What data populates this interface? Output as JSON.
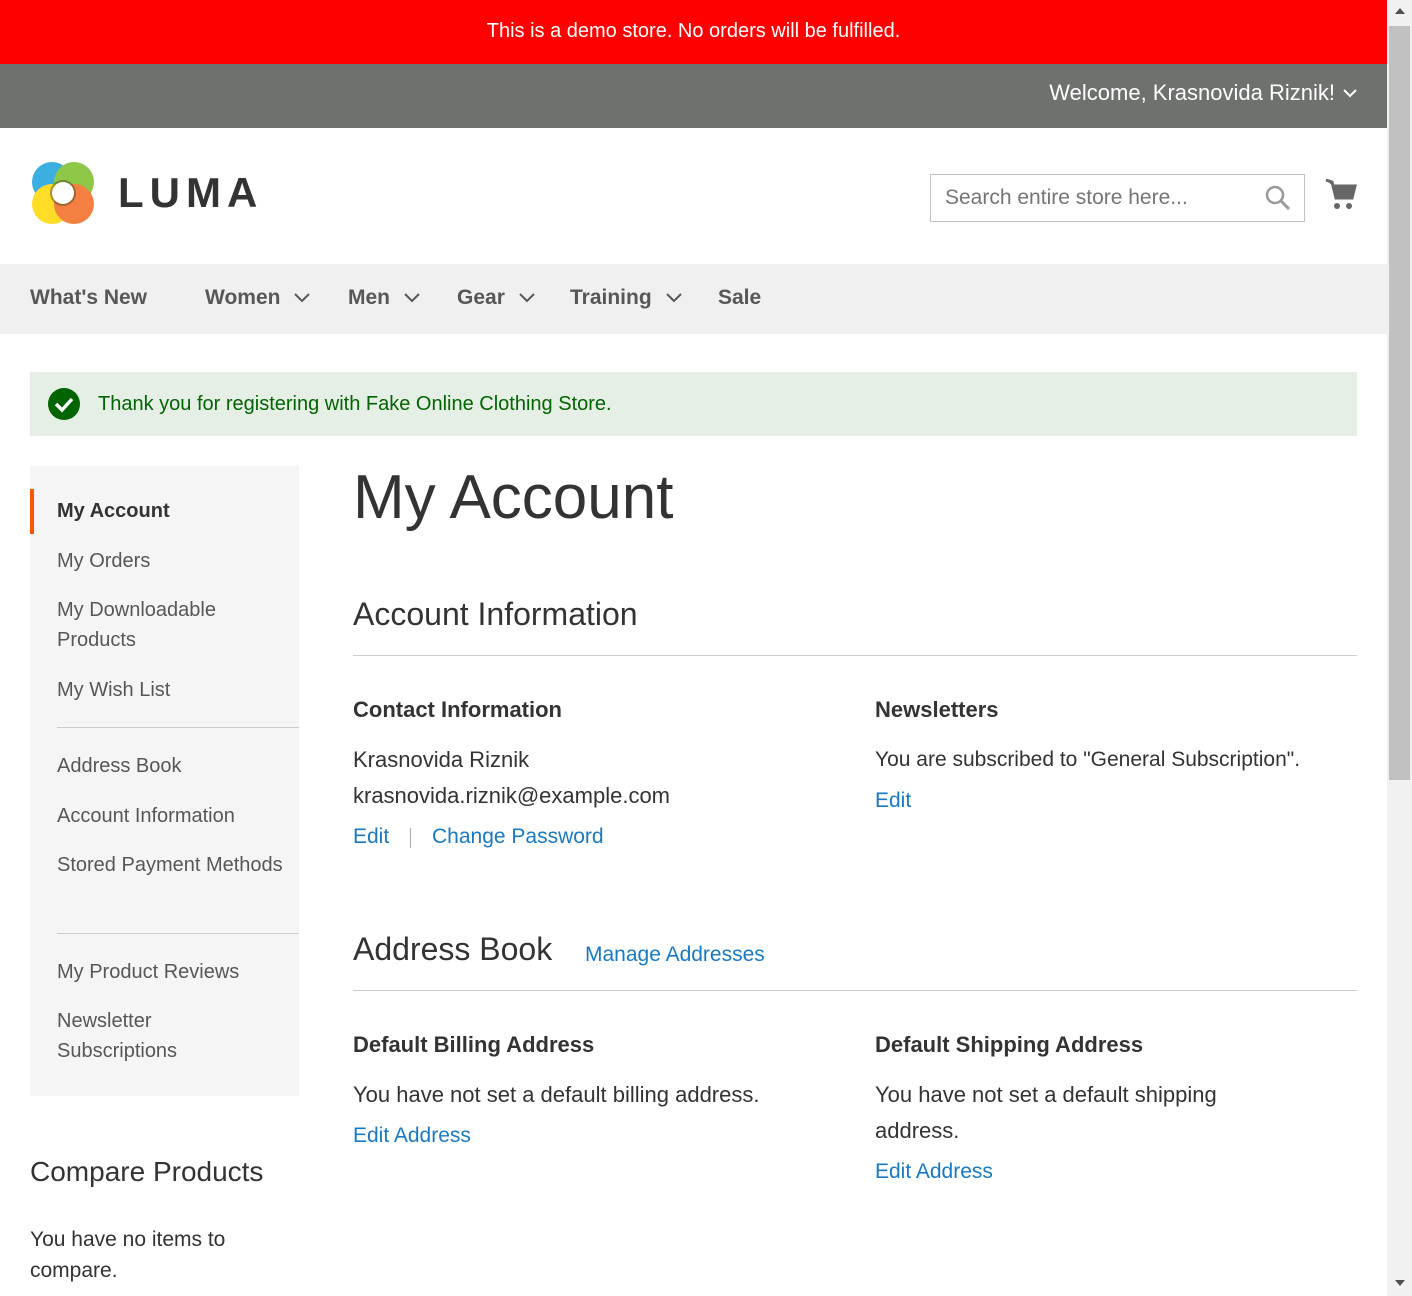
{
  "demo_notice": "This is a demo store. No orders will be fulfilled.",
  "header": {
    "welcome": "Welcome, Krasnovida Riznik!",
    "logo_text": "LUMA",
    "search_placeholder": "Search entire store here..."
  },
  "nav": [
    {
      "label": "What's New"
    },
    {
      "label": "Women"
    },
    {
      "label": "Men"
    },
    {
      "label": "Gear"
    },
    {
      "label": "Training"
    },
    {
      "label": "Sale"
    }
  ],
  "message": "Thank you for registering with Fake Online Clothing Store.",
  "sidebar": {
    "items": [
      "My Account",
      "My Orders",
      "My Downloadable Products",
      "My Wish List",
      "Address Book",
      "Account Information",
      "Stored Payment Methods",
      "My Product Reviews",
      "Newsletter Subscriptions"
    ]
  },
  "compare": {
    "title": "Compare Products",
    "empty": "You have no items to compare."
  },
  "main": {
    "title": "My Account",
    "account_info": {
      "title": "Account Information",
      "contact": {
        "title": "Contact Information",
        "name": "Krasnovida Riznik",
        "email": "krasnovida.riznik@example.com",
        "edit": "Edit",
        "change_password": "Change Password"
      },
      "newsletters": {
        "title": "Newsletters",
        "text": "You are subscribed to \"General Subscription\".",
        "edit": "Edit"
      }
    },
    "address_book": {
      "title": "Address Book",
      "manage": "Manage Addresses",
      "billing": {
        "title": "Default Billing Address",
        "text": "You have not set a default billing address.",
        "edit": "Edit Address"
      },
      "shipping": {
        "title": "Default Shipping Address",
        "text": "You have not set a default shipping address.",
        "edit": "Edit Address"
      }
    }
  },
  "colors": {
    "demo": "#ff0000",
    "topbar": "#6e716e",
    "link": "#1979c3",
    "success": "#006400",
    "accent": "#ff5501"
  }
}
